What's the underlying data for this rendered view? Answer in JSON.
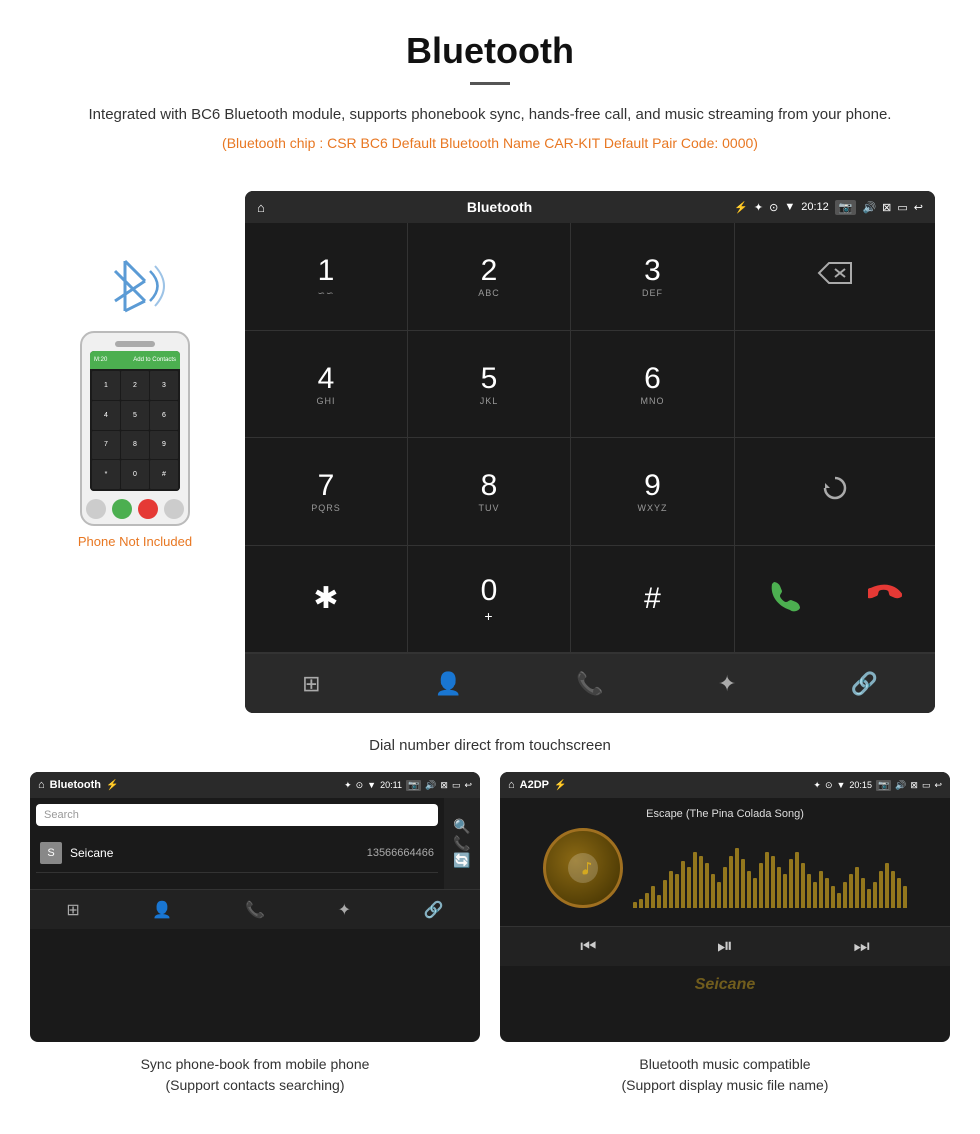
{
  "header": {
    "title": "Bluetooth",
    "description": "Integrated with BC6 Bluetooth module, supports phonebook sync, hands-free call, and music streaming from your phone.",
    "specs": "(Bluetooth chip : CSR BC6    Default Bluetooth Name CAR-KIT    Default Pair Code: 0000)"
  },
  "phone_illustration": {
    "not_included_label": "Phone Not Included"
  },
  "dialer_screen": {
    "status_bar": {
      "left_icon": "⌂",
      "title": "Bluetooth",
      "usb_icon": "⚡",
      "time": "20:12",
      "icons_right": [
        "📷",
        "🔊",
        "⊠",
        "▭",
        "↩"
      ]
    },
    "keys": [
      {
        "main": "1",
        "sub": "∽∽"
      },
      {
        "main": "2",
        "sub": "ABC"
      },
      {
        "main": "3",
        "sub": "DEF"
      },
      {
        "main": "4",
        "sub": "GHI"
      },
      {
        "main": "5",
        "sub": "JKL"
      },
      {
        "main": "6",
        "sub": "MNO"
      },
      {
        "main": "7",
        "sub": "PQRS"
      },
      {
        "main": "8",
        "sub": "TUV"
      },
      {
        "main": "9",
        "sub": "WXYZ"
      },
      {
        "main": "✱",
        "sub": ""
      },
      {
        "main": "0",
        "sub": "+"
      },
      {
        "main": "#",
        "sub": ""
      }
    ],
    "caption": "Dial number direct from touchscreen"
  },
  "phonebook_screen": {
    "status_bar": {
      "left_icon": "⌂",
      "title": "Bluetooth",
      "usb_icon": "⚡",
      "time": "20:11"
    },
    "search_placeholder": "Search",
    "contacts": [
      {
        "letter": "S",
        "name": "Seicane",
        "phone": "13566664466"
      }
    ],
    "caption_line1": "Sync phone-book from mobile phone",
    "caption_line2": "(Support contacts searching)"
  },
  "music_screen": {
    "status_bar": {
      "left_icon": "⌂",
      "title": "A2DP",
      "usb_icon": "⚡",
      "time": "20:15"
    },
    "song_title": "Escape (The Pina Colada Song)",
    "caption_line1": "Bluetooth music compatible",
    "caption_line2": "(Support display music file name)"
  },
  "visualizer_bars": [
    3,
    5,
    8,
    12,
    7,
    15,
    20,
    18,
    25,
    22,
    30,
    28,
    24,
    18,
    14,
    22,
    28,
    32,
    26,
    20,
    16,
    24,
    30,
    28,
    22,
    18,
    26,
    30,
    24,
    18,
    14,
    20,
    16,
    12,
    8,
    14,
    18,
    22,
    16,
    10,
    14,
    20,
    24,
    20,
    16,
    12
  ],
  "colors": {
    "accent_orange": "#e87722",
    "android_bg": "#1a1a1a",
    "android_bar": "#2a2a2a",
    "green_call": "#4CAF50",
    "red_call": "#e53935",
    "text_light": "#ffffff",
    "text_dim": "#aaaaaa"
  }
}
